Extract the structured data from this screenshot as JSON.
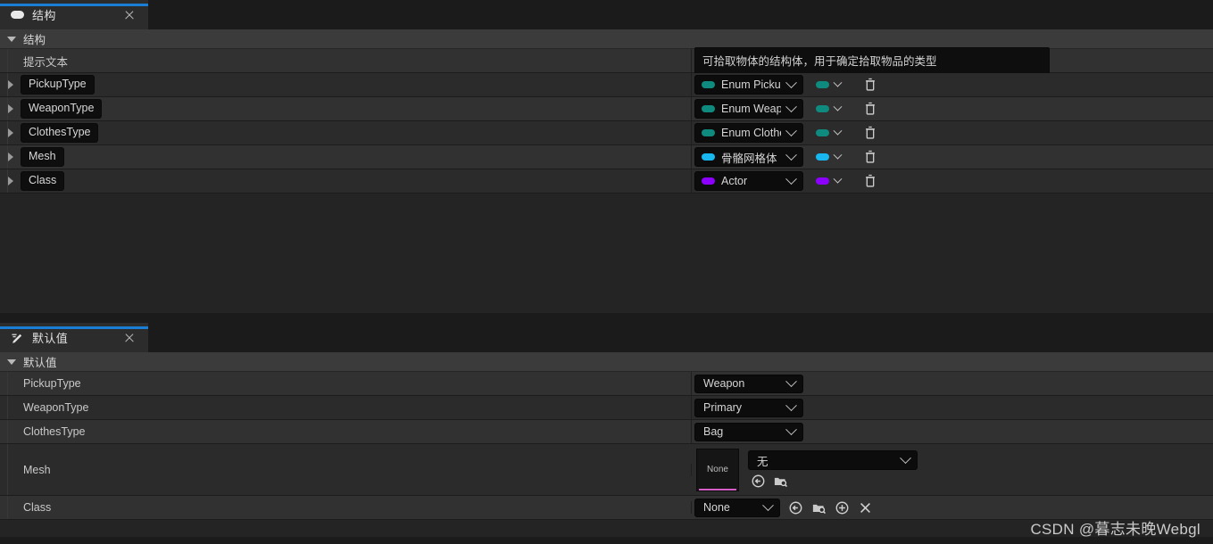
{
  "colors": {
    "accent_tab": "#1a7fd4",
    "enum_pill": "#0f8a7e",
    "mesh_pill": "#19b7f0",
    "class_pill": "#8b00ff",
    "thumb_underline": "#d65cc8"
  },
  "struct_panel": {
    "tab": {
      "label": "结构",
      "icon": "struct-pill-icon",
      "close": "×"
    },
    "section": {
      "label": "结构"
    },
    "tooltip_row": {
      "label": "提示文本",
      "value": "可拾取物体的结构体，用于确定拾取物品的类型"
    },
    "variables": [
      {
        "name": "PickupType",
        "type": "Enum Pickup",
        "pill": "#0f8a7e",
        "container": "single",
        "delete": "delete-icon"
      },
      {
        "name": "WeaponType",
        "type": "Enum Weapon",
        "pill": "#0f8a7e",
        "container": "single",
        "delete": "delete-icon"
      },
      {
        "name": "ClothesType",
        "type": "Enum Clothes",
        "pill": "#0f8a7e",
        "container": "single",
        "delete": "delete-icon"
      },
      {
        "name": "Mesh",
        "type": "骨骼网格体",
        "pill": "#19b7f0",
        "container": "single",
        "delete": "delete-icon"
      },
      {
        "name": "Class",
        "type": "Actor",
        "pill": "#8b00ff",
        "container": "single",
        "delete": "delete-icon"
      }
    ]
  },
  "defaults_panel": {
    "tab": {
      "label": "默认值",
      "icon": "pencil-icon",
      "close": "×"
    },
    "section": {
      "label": "默认值"
    },
    "rows": [
      {
        "label": "PickupType",
        "value": "Weapon"
      },
      {
        "label": "WeaponType",
        "value": "Primary"
      },
      {
        "label": "ClothesType",
        "value": "Bag"
      }
    ],
    "mesh_row": {
      "label": "Mesh",
      "thumbnail_text": "None",
      "asset_value": "无",
      "actions": [
        "use-selected-asset-icon",
        "browse-asset-icon"
      ]
    },
    "class_row": {
      "label": "Class",
      "value": "None",
      "actions": [
        "use-selected-asset-icon",
        "browse-asset-icon",
        "new-asset-icon",
        "clear-asset-icon"
      ]
    }
  },
  "watermark": {
    "text": "CSDN @暮志未晚Webgl"
  }
}
